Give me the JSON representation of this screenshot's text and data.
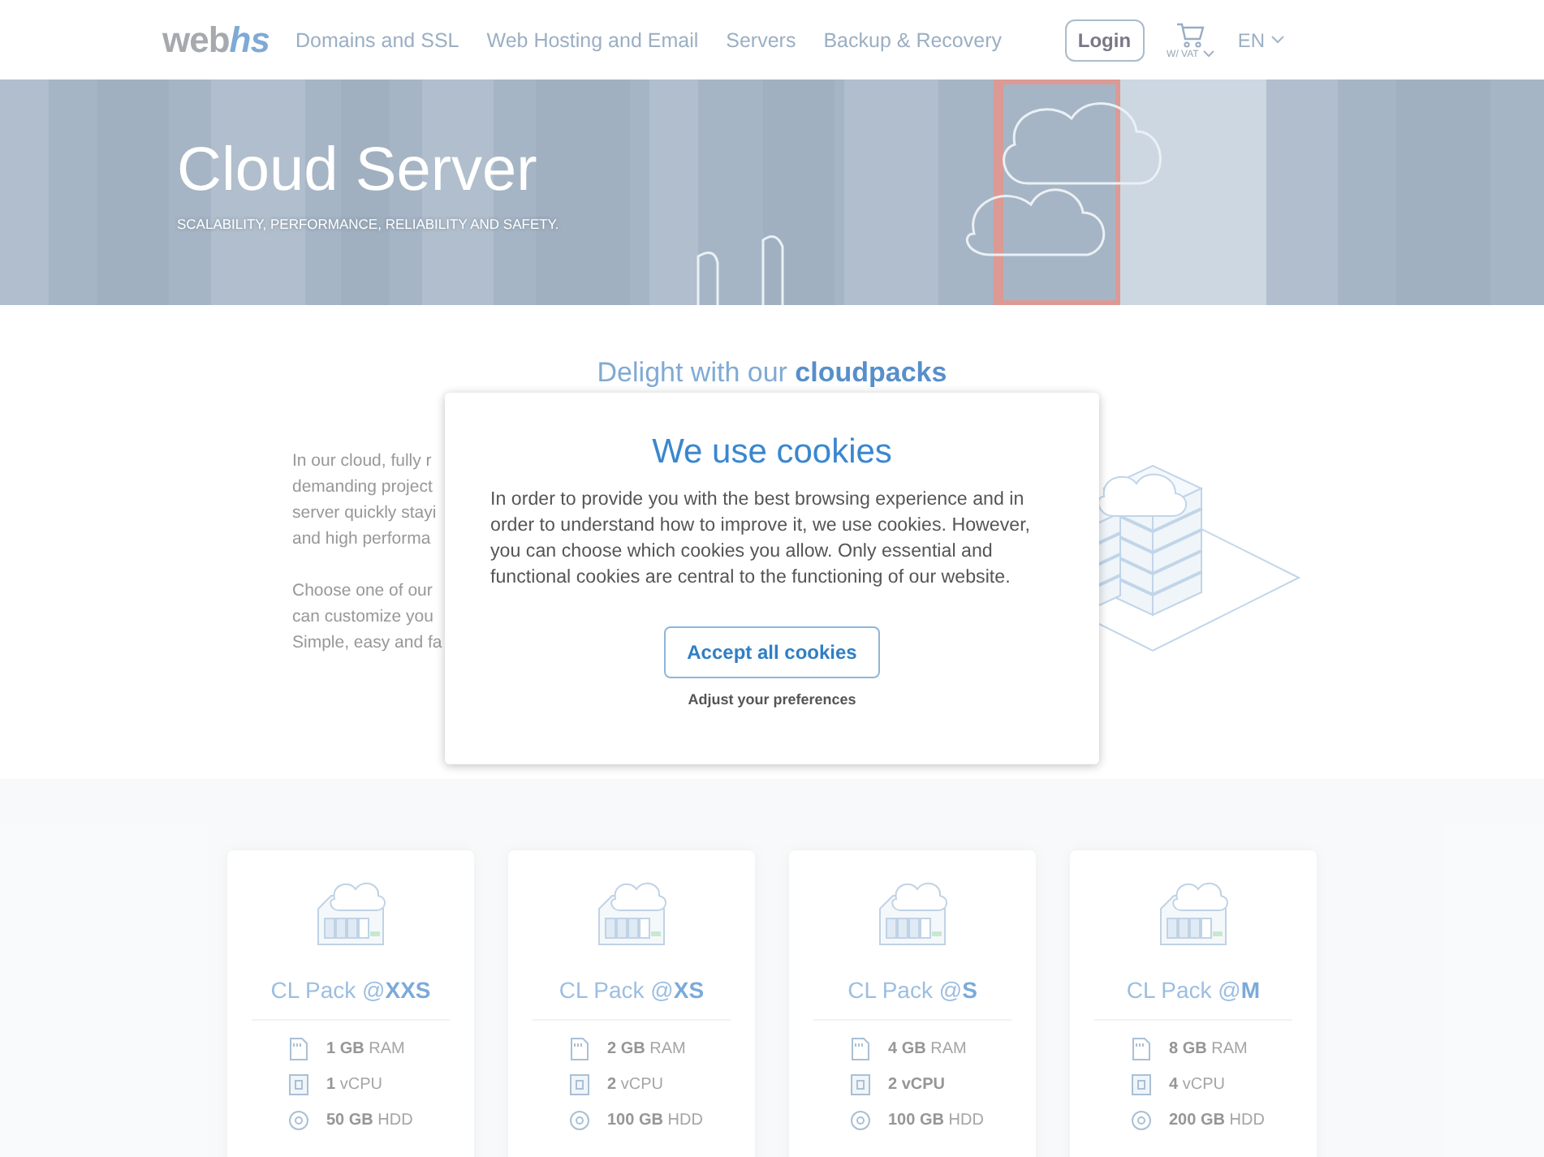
{
  "header": {
    "logo": {
      "part1": "web",
      "part2": "hs"
    },
    "nav": [
      "Domains and SSL",
      "Web Hosting and Email",
      "Servers",
      "Backup & Recovery"
    ],
    "login": "Login",
    "cart_label": "W/ VAT",
    "language": "EN"
  },
  "hero": {
    "kind": "picture",
    "title": "Cloud Server",
    "subtitle": "SCALABILITY, PERFORMANCE, RELIABILITY AND SAFETY."
  },
  "intro": {
    "heading": "Delight with our **cloudpacks**",
    "paragraphs": [
      [
        "In our cloud, fully r",
        "demanding project",
        "server quickly stayi",
        "and high performa"
      ],
      [
        "Choose one of our",
        "can customize you",
        "Simple, easy and fa"
      ]
    ]
  },
  "packs": [
    {
      "name": "CL Pack @**XXS**",
      "specs": [
        {
          "kind": "ram",
          "text": "**1 GB** RAM"
        },
        {
          "kind": "cpu",
          "text": "**1** vCPU"
        },
        {
          "kind": "disk",
          "text": "**50 GB** HDD"
        }
      ]
    },
    {
      "name": "CL Pack @**XS**",
      "specs": [
        {
          "kind": "ram",
          "text": "**2 GB** RAM"
        },
        {
          "kind": "cpu",
          "text": "**2** vCPU"
        },
        {
          "kind": "disk",
          "text": "**100 GB** HDD"
        }
      ]
    },
    {
      "name": "CL Pack @**S**",
      "specs": [
        {
          "kind": "ram",
          "text": "**4 GB** RAM"
        },
        {
          "kind": "cpu",
          "text": "**2 vCPU**"
        },
        {
          "kind": "disk",
          "text": "**100 GB** HDD"
        }
      ]
    },
    {
      "name": "CL Pack @**M**",
      "specs": [
        {
          "kind": "ram",
          "text": "**8 GB** RAM"
        },
        {
          "kind": "cpu",
          "text": "**4** vCPU"
        },
        {
          "kind": "disk",
          "text": "**200 GB** HDD"
        }
      ]
    }
  ],
  "cookie_dialog": {
    "title": "We use cookies",
    "text": "In order to provide you with the best browsing experience and in order to understand how to improve it, we use cookies. However, you can choose which cookies you allow. Only essential and functional cookies are central to the functioning of our website.",
    "accept": "Accept all cookies",
    "preferences": "Adjust your preferences"
  }
}
